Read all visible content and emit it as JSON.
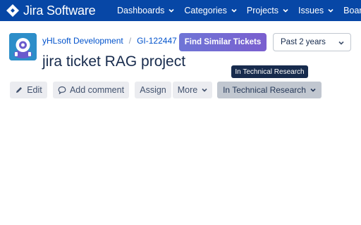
{
  "topbar": {
    "brand": "Jira Software",
    "brand_icon": "jira-diamond-icon",
    "bg_color": "#0747a6",
    "nav": [
      {
        "label": "Dashboards"
      },
      {
        "label": "Categories"
      },
      {
        "label": "Projects"
      },
      {
        "label": "Issues"
      },
      {
        "label": "Boards"
      }
    ]
  },
  "issue": {
    "project_link": "yHLsoft Development",
    "separator": "/",
    "issue_key": "GI-122447",
    "title": "jira ticket RAG project"
  },
  "actions": {
    "find_similar": "Find Similar Tickets",
    "time_range": "Past 2 years",
    "tooltip": "In Technical Research",
    "edit": "Edit",
    "add_comment": "Add comment",
    "assign": "Assign",
    "more": "More",
    "status": "In Technical Research"
  }
}
